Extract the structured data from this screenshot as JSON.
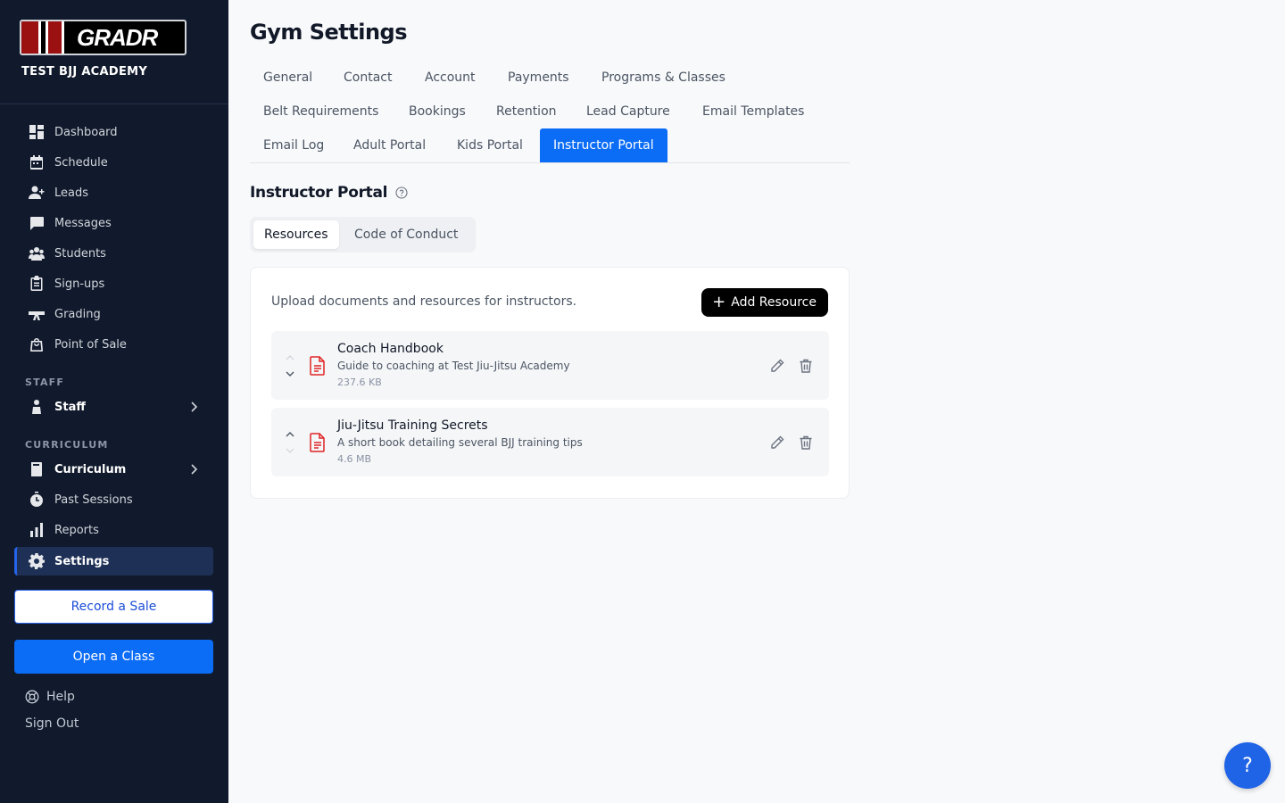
{
  "brand": {
    "logo_text": "GRADR",
    "academy": "TEST BJJ ACADEMY"
  },
  "sidebar": {
    "items": [
      {
        "label": "Dashboard",
        "icon": "dashboard-icon"
      },
      {
        "label": "Schedule",
        "icon": "calendar-icon"
      },
      {
        "label": "Leads",
        "icon": "add-person-icon"
      },
      {
        "label": "Messages",
        "icon": "message-icon"
      },
      {
        "label": "Students",
        "icon": "students-icon"
      },
      {
        "label": "Sign-ups",
        "icon": "clipboard-icon"
      },
      {
        "label": "Grading",
        "icon": "belt-icon"
      },
      {
        "label": "Point of Sale",
        "icon": "shopping-bag-icon"
      }
    ],
    "staff_section": "STAFF",
    "staff_item": "Staff",
    "curriculum_section": "CURRICULUM",
    "curriculum_item": "Curriculum",
    "past_sessions": "Past Sessions",
    "reports": "Reports",
    "settings": "Settings",
    "record_sale": "Record a Sale",
    "open_class": "Open a Class",
    "help": "Help",
    "sign_out": "Sign Out"
  },
  "main": {
    "title": "Gym Settings",
    "tabs": [
      "General",
      "Contact",
      "Account",
      "Payments",
      "Programs & Classes",
      "Belt Requirements",
      "Bookings",
      "Retention",
      "Lead Capture",
      "Email Templates",
      "Email Log",
      "Adult Portal",
      "Kids Portal",
      "Instructor Portal"
    ],
    "active_tab": "Instructor Portal",
    "section_title": "Instructor Portal",
    "subtabs": [
      "Resources",
      "Code of Conduct"
    ],
    "active_subtab": "Resources",
    "card_description": "Upload documents and resources for instructors.",
    "add_button": "Add Resource",
    "resources": [
      {
        "name": "Coach Handbook",
        "description": "Guide to coaching at Test Jiu-Jitsu Academy",
        "size": "237.6 KB"
      },
      {
        "name": "Jiu-Jitsu Training Secrets",
        "description": "A short book detailing several BJJ training tips",
        "size": "4.6 MB"
      }
    ]
  },
  "fab_label": "?",
  "colors": {
    "sidebar_bg": "#111a2c",
    "accent": "#0b6cf5",
    "file_icon": "#e02424"
  }
}
